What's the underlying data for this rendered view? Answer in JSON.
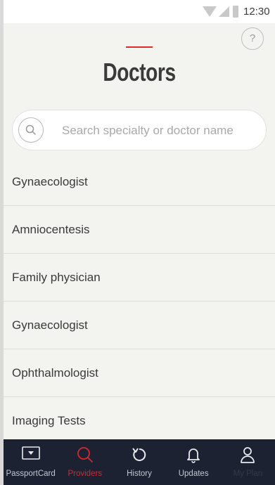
{
  "status_bar": {
    "time": "12:30",
    "icons": [
      "wifi-icon",
      "signal-icon",
      "battery-icon"
    ]
  },
  "header": {
    "help_label": "?",
    "title": "Doctors",
    "accent_color": "#e02a2a"
  },
  "search": {
    "placeholder": "Search specialty or doctor name",
    "value": ""
  },
  "list": {
    "items": [
      {
        "label": "Gynaecologist"
      },
      {
        "label": "Amniocentesis"
      },
      {
        "label": "Family physician"
      },
      {
        "label": "Gynaecologist"
      },
      {
        "label": "Ophthalmologist"
      },
      {
        "label": "Imaging Tests"
      }
    ]
  },
  "tabbar": {
    "background": "#1d2233",
    "active_color": "#d8262e",
    "tabs": [
      {
        "label": "PassportCard",
        "icon": "card-icon"
      },
      {
        "label": "Providers",
        "icon": "search-icon",
        "active": true
      },
      {
        "label": "History",
        "icon": "history-icon"
      },
      {
        "label": "Updates",
        "icon": "bell-icon"
      },
      {
        "label": "My Plan",
        "icon": "user-icon"
      }
    ]
  }
}
